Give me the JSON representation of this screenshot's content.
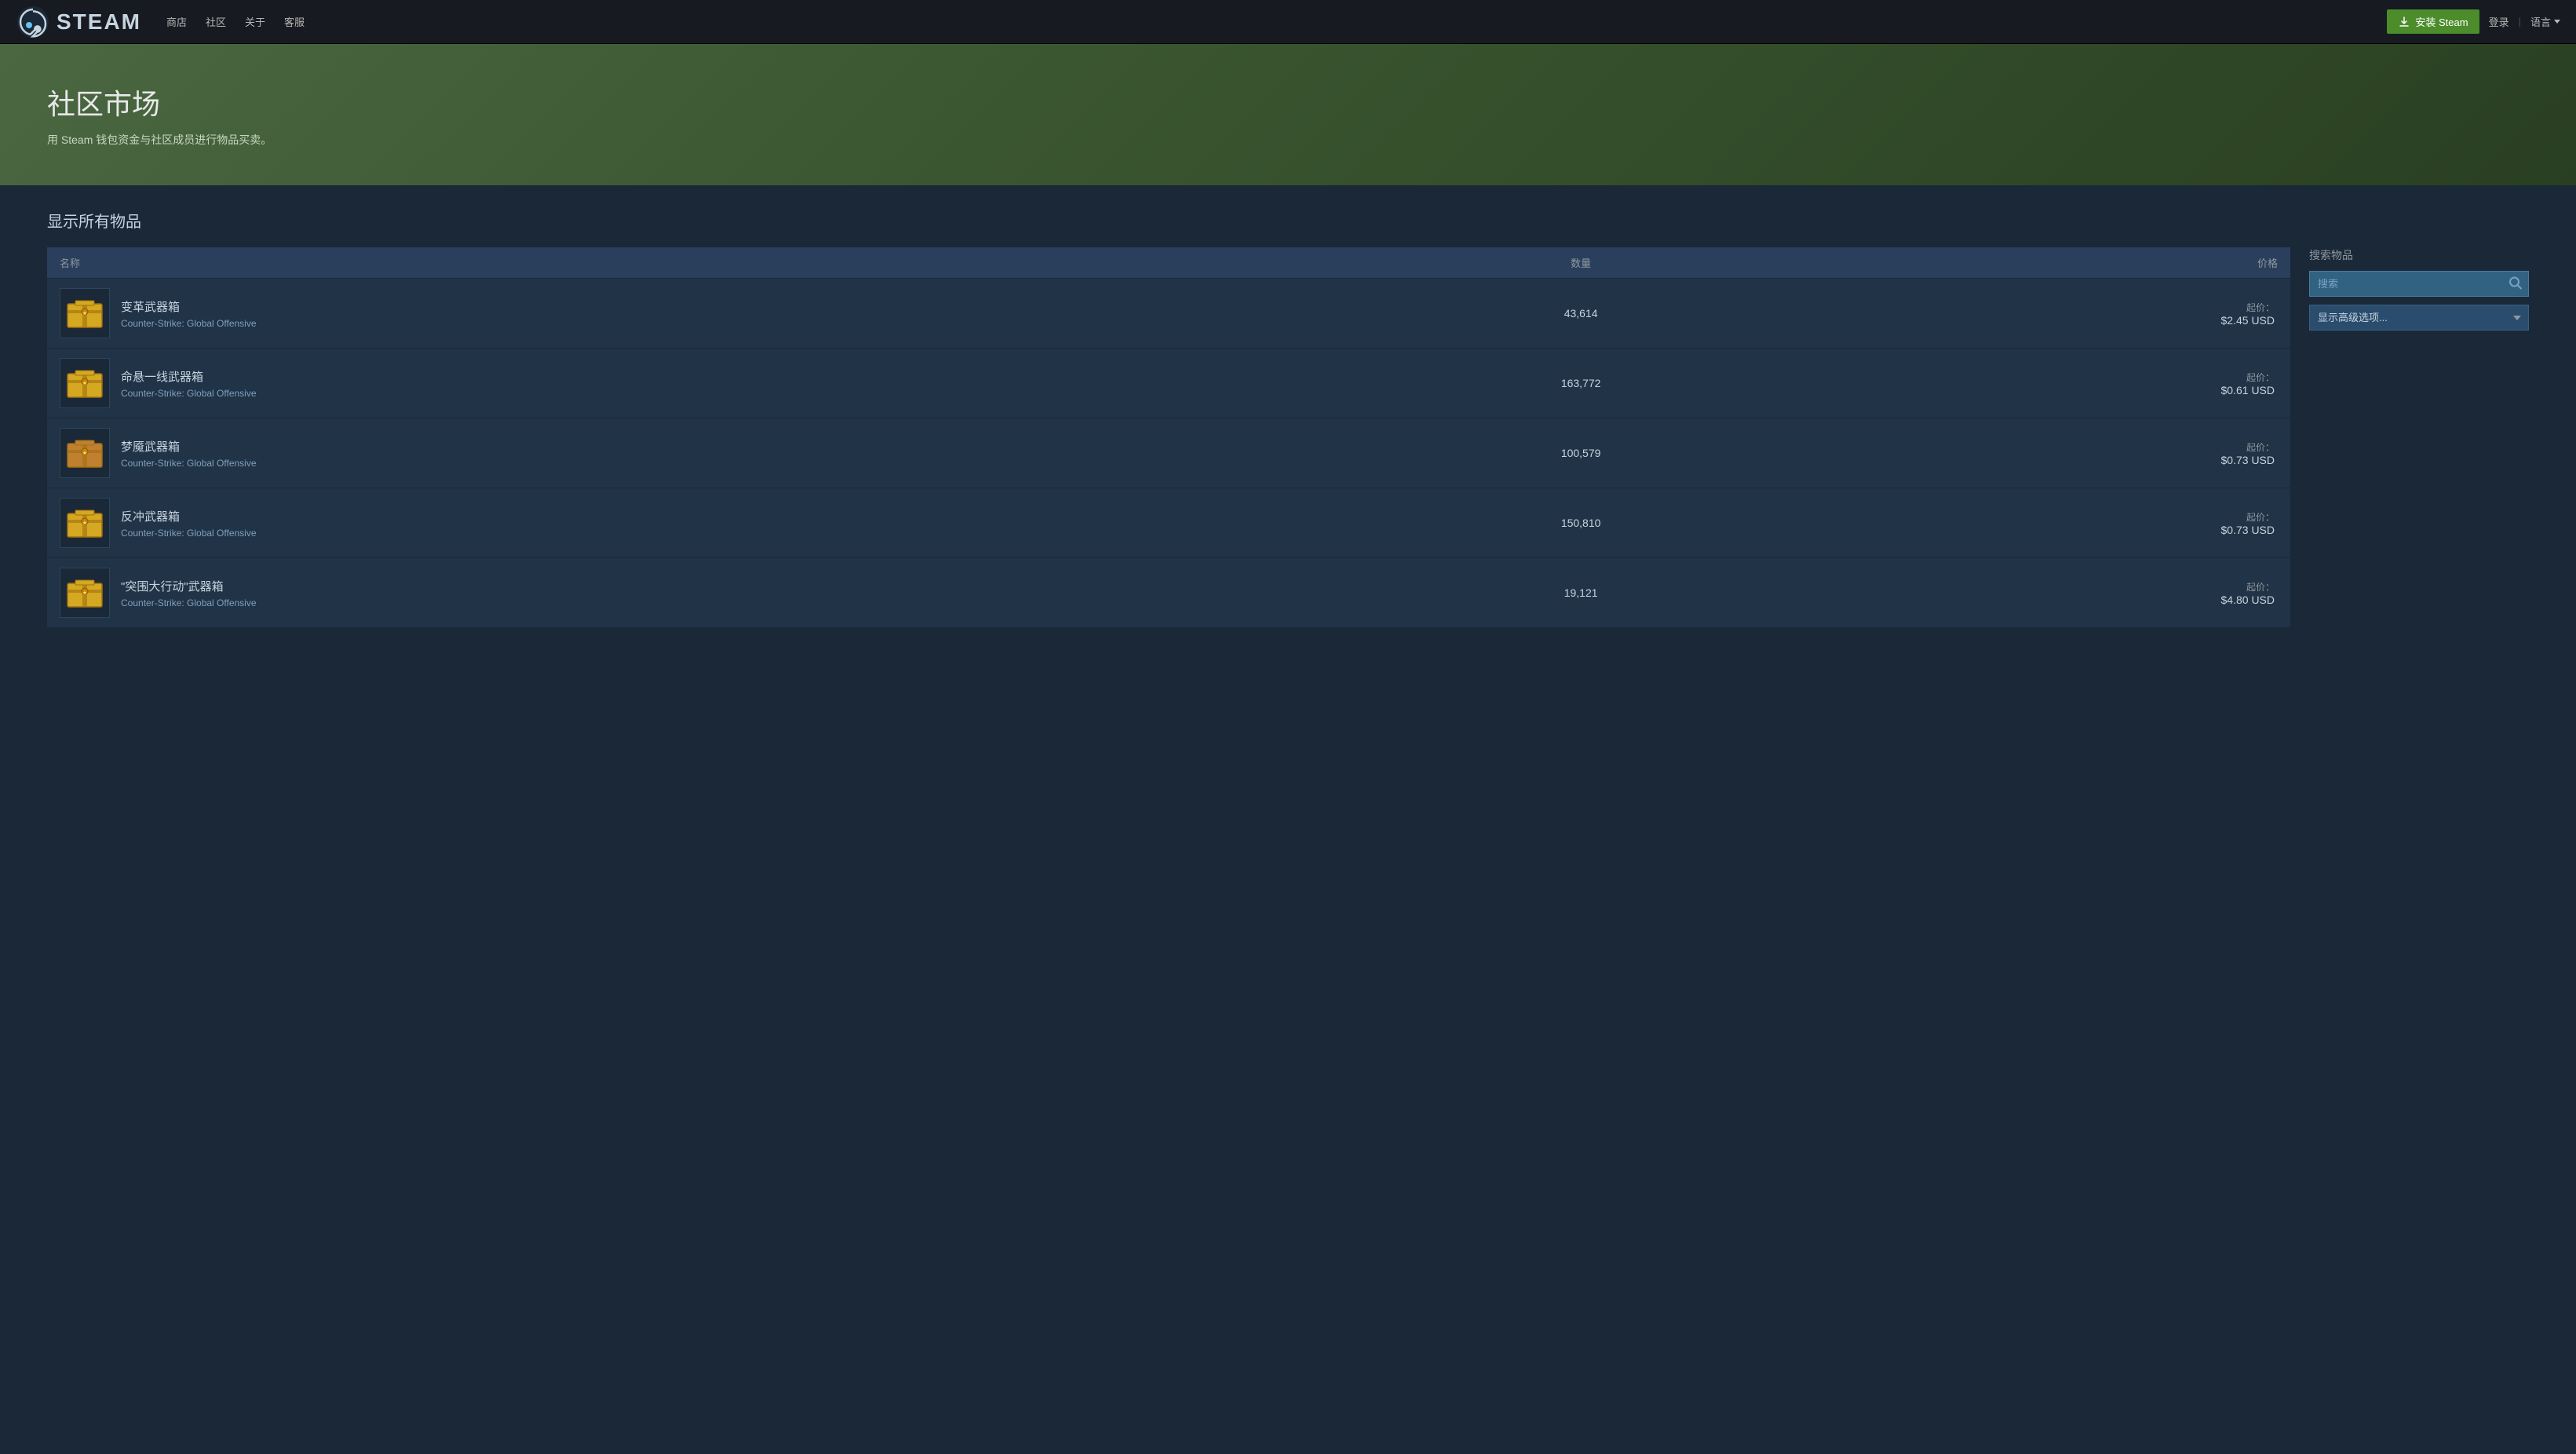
{
  "topbar": {
    "logo_text": "STEAM",
    "nav": [
      {
        "label": "商店"
      },
      {
        "label": "社区"
      },
      {
        "label": "关于"
      },
      {
        "label": "客服"
      }
    ],
    "install_label": "安装 Steam",
    "login_label": "登录",
    "divider": "|",
    "lang_label": "语言"
  },
  "hero": {
    "title": "社区市场",
    "subtitle": "用 Steam 钱包资金与社区成员进行物品买卖。"
  },
  "main": {
    "section_title": "显示所有物品",
    "table": {
      "headers": [
        {
          "label": "名称",
          "align": "left"
        },
        {
          "label": "数量",
          "align": "center"
        },
        {
          "label": "价格",
          "align": "right"
        }
      ],
      "rows": [
        {
          "name": "变革武器箱",
          "game": "Counter-Strike: Global Offensive",
          "quantity": "43,614",
          "price_label": "起价：",
          "price": "$2.45 USD",
          "color": "#d4a820"
        },
        {
          "name": "命悬一线武器箱",
          "game": "Counter-Strike: Global Offensive",
          "quantity": "163,772",
          "price_label": "起价：",
          "price": "$0.61 USD",
          "color": "#d4a820"
        },
        {
          "name": "梦魇武器箱",
          "game": "Counter-Strike: Global Offensive",
          "quantity": "100,579",
          "price_label": "起价：",
          "price": "$0.73 USD",
          "color": "#c08030"
        },
        {
          "name": "反冲武器箱",
          "game": "Counter-Strike: Global Offensive",
          "quantity": "150,810",
          "price_label": "起价：",
          "price": "$0.73 USD",
          "color": "#d4a820"
        },
        {
          "name": "\"突围大行动\"武器箱",
          "game": "Counter-Strike: Global Offensive",
          "quantity": "19,121",
          "price_label": "起价：",
          "price": "$4.80 USD",
          "color": "#d4a820"
        }
      ]
    }
  },
  "sidebar": {
    "title": "搜索物品",
    "search_placeholder": "搜索",
    "advanced_label": "显示高级选项..."
  }
}
